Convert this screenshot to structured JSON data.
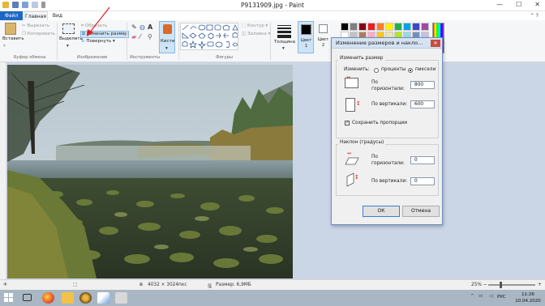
{
  "window": {
    "title": "P9131909.jpg - Paint",
    "min": "—",
    "max": "☐",
    "close": "✕"
  },
  "tabs": {
    "file": "Файл",
    "home": "Главная",
    "view": "Вид"
  },
  "ribbon": {
    "paste": "Вставить",
    "cut": "Вырезать",
    "copy": "Копировать",
    "clipboard_group": "Буфер обмена",
    "select": "Выделить",
    "crop": "Обрезать",
    "resize": "Изменить размер",
    "rotate": "Повернуть",
    "image_group": "Изображение",
    "tools_group": "Инструменты",
    "brushes": "Кисти",
    "outline": "Контур",
    "fill": "Заливка",
    "shapes_group": "Фигуры",
    "size": "Толщина",
    "color1": "Цвет 1",
    "color2": "Цвет 2",
    "colors": [
      "#000000",
      "#7f7f7f",
      "#880015",
      "#ed1c24",
      "#ff7f27",
      "#fff200",
      "#22b14c",
      "#00a2e8",
      "#3f48cc",
      "#a349a4",
      "#ffffff",
      "#c3c3c3",
      "#b97a57",
      "#ffaec9",
      "#ffc90e",
      "#efe4b0",
      "#b5e61d",
      "#99d9ea",
      "#7092be",
      "#c8bfe7"
    ]
  },
  "dialog": {
    "title": "Изменение размеров и накло...",
    "close": "✕",
    "resize_section": "Изменить размер",
    "by_label": "Изменить:",
    "percent": "проценты",
    "pixels": "пиксели",
    "h_label": "По горизонтали:",
    "h_value": "800",
    "v_label": "По вертикали:",
    "v_value": "600",
    "keep_ratio": "Сохранить пропорции",
    "skew_section": "Наклон (градусы)",
    "skew_h_label": "По горизонтали:",
    "skew_h_value": "0",
    "skew_v_label": "По вертикали:",
    "skew_v_value": "0",
    "ok": "ОК",
    "cancel": "Отмена"
  },
  "status": {
    "dimensions": "4032 × 3024пкс",
    "size": "Размер: 6,9МБ",
    "zoom": "25%"
  },
  "taskbar": {
    "lang": "РУС",
    "time": "11:26",
    "date": "10.04.2020"
  }
}
